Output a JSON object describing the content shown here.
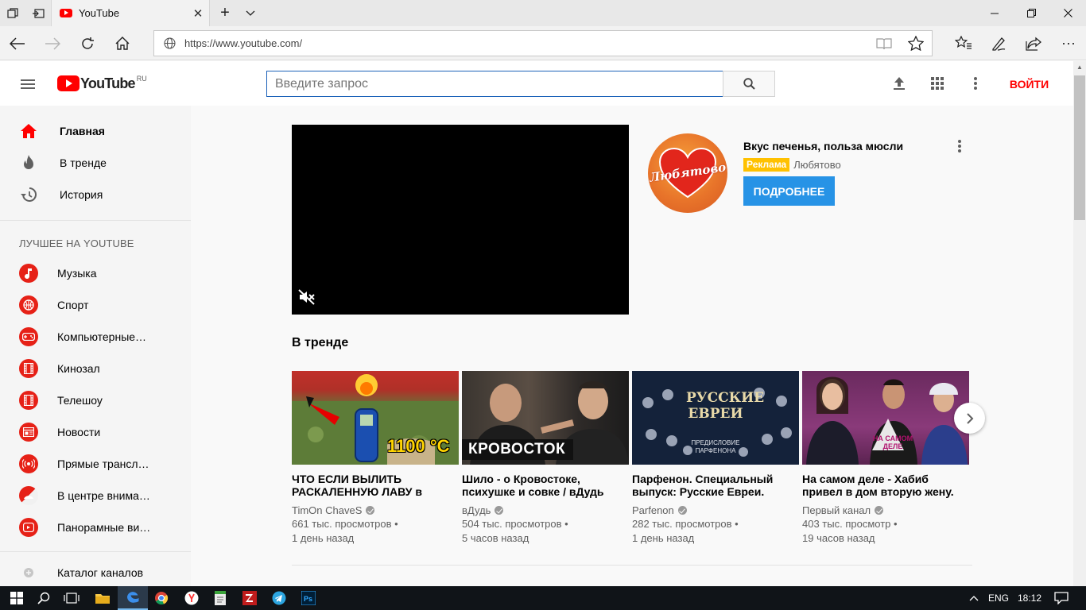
{
  "browser": {
    "tab_title": "YouTube",
    "url": "https://www.youtube.com/"
  },
  "masthead": {
    "logo_text": "YouTube",
    "logo_region": "RU",
    "search_placeholder": "Введите запрос",
    "signin_label": "ВОЙТИ"
  },
  "sidebar": {
    "main_items": [
      {
        "label": "Главная",
        "icon": "home-icon",
        "active": true
      },
      {
        "label": "В тренде",
        "icon": "flame-icon",
        "active": false
      },
      {
        "label": "История",
        "icon": "history-icon",
        "active": false
      }
    ],
    "best_header": "ЛУЧШЕЕ НА YOUTUBE",
    "channels": [
      {
        "label": "Музыка",
        "icon": "music-icon"
      },
      {
        "label": "Спорт",
        "icon": "sport-icon"
      },
      {
        "label": "Компьютерные…",
        "icon": "gamepad-icon"
      },
      {
        "label": "Кинозал",
        "icon": "film-icon"
      },
      {
        "label": "Телешоу",
        "icon": "tv-show-icon"
      },
      {
        "label": "Новости",
        "icon": "news-icon"
      },
      {
        "label": "Прямые трансл…",
        "icon": "live-icon"
      },
      {
        "label": "В центре внима…",
        "icon": "spotlight-icon"
      },
      {
        "label": "Панорамные ви…",
        "icon": "panorama-icon"
      }
    ],
    "catalog_label": "Каталог каналов"
  },
  "ad": {
    "logo_text": "Любятово",
    "title": "Вкус печенья, польза мюсли",
    "badge": "Реклама",
    "advertiser": "Любятово",
    "cta": "ПОДРОБНЕЕ"
  },
  "trending": {
    "title": "В тренде",
    "videos": [
      {
        "title": "ЧТО ЕСЛИ ВЫЛИТЬ РАСКАЛЕННУЮ ЛАВУ в",
        "channel": "TimOn ChaveS",
        "views": "661 тыс. просмотров",
        "age": "1 день назад",
        "thumb_text": "1100 °C"
      },
      {
        "title": "Шило - о Кровостоке, психушке и совке / вДудь",
        "channel": "вДудь",
        "views": "504 тыс. просмотров",
        "age": "5 часов назад",
        "thumb_text": "КРОВОСТОК"
      },
      {
        "title": "Парфенон. Специальный выпуск: Русские Евреи.",
        "channel": "Parfenon",
        "views": "282 тыс. просмотров",
        "age": "1 день назад",
        "thumb_text": "РУССКИЕ ЕВРЕИ",
        "thumb_sub": "ПРЕДИСЛОВИЕ ПАРФЕНОНА"
      },
      {
        "title": "На самом деле - Хабиб привел в дом вторую жену.",
        "channel": "Первый канал",
        "views": "403 тыс. просмотр",
        "age": "19 часов назад",
        "thumb_text": "НА САМОМ ДЕЛЕ"
      }
    ]
  },
  "taskbar": {
    "lang": "ENG",
    "time": "18:12"
  },
  "colors": {
    "youtube_red": "#ff0000",
    "cta_blue": "#2793e6",
    "ad_badge": "#ffc100"
  }
}
